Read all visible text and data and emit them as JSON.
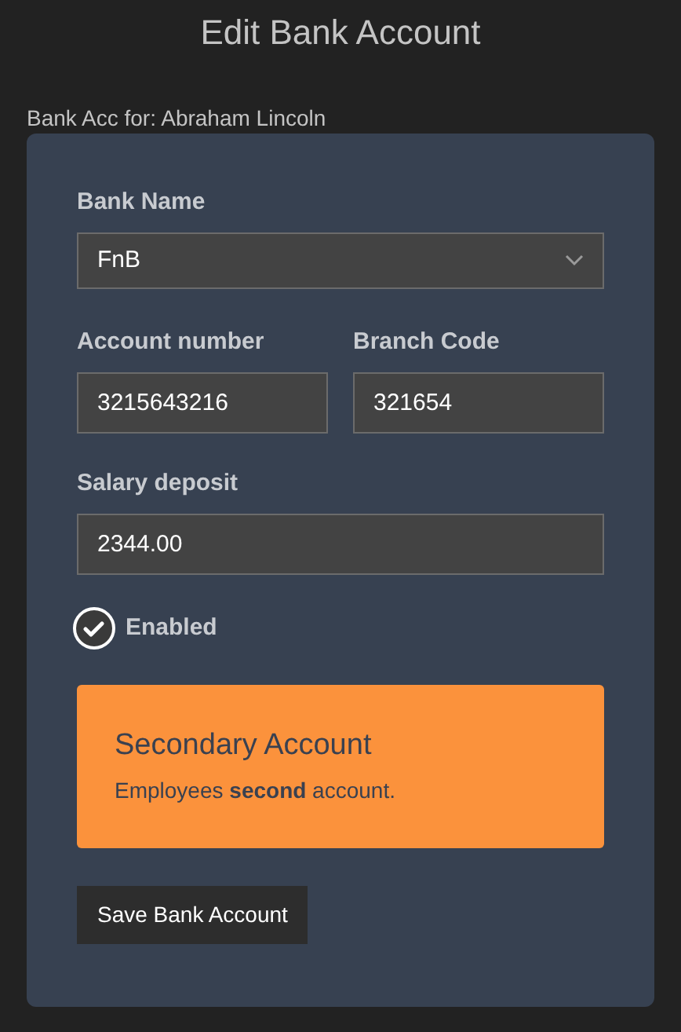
{
  "title": "Edit Bank Account",
  "subtitle": "Bank Acc for: Abraham Lincoln",
  "bank_name": {
    "label": "Bank Name",
    "value": "FnB"
  },
  "account_number": {
    "label": "Account number",
    "value": "3215643216"
  },
  "branch_code": {
    "label": "Branch Code",
    "value": "321654"
  },
  "salary_deposit": {
    "label": "Salary deposit",
    "value": "2344.00"
  },
  "enabled": {
    "label": "Enabled",
    "checked": true
  },
  "notice": {
    "title": "Secondary Account",
    "text": "Employees **second** account."
  },
  "save_button": "Save Bank Account"
}
